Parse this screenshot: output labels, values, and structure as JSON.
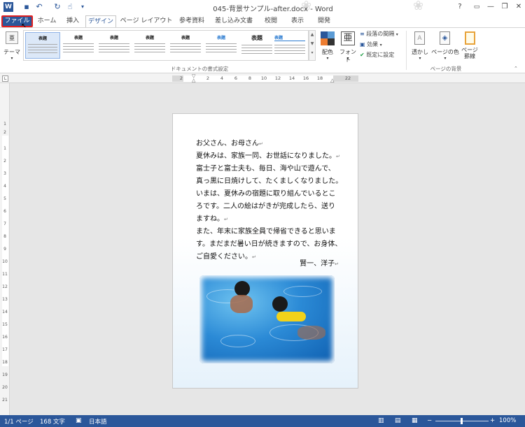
{
  "titlebar": {
    "app_icon": "W",
    "title": "045-背景サンプル-after.docx - Word",
    "help": "?",
    "minimize": "—",
    "restore": "❐",
    "close": "✕"
  },
  "tabs": [
    "ファイル",
    "ホーム",
    "挿入",
    "デザイン",
    "ページ レイアウト",
    "参考資料",
    "差し込み文書",
    "校閲",
    "表示",
    "開発"
  ],
  "ribbon": {
    "theme_label": "テーマ",
    "thumb_titles": [
      "表題",
      "表題",
      "表題",
      "表題",
      "表題",
      "表題",
      "表題",
      "表題"
    ],
    "colors_label": "配色",
    "fonts_label": "フォント",
    "fonts_glyph": "亜",
    "paragraph_spacing": "段落の間隔",
    "effects": "効果",
    "set_default": "既定に設定",
    "doc_format_group": "ドキュメントの書式設定",
    "watermark_label": "透かし",
    "page_color_label": "ページの色",
    "page_borders_label": "ページ\n罫線",
    "page_bg_group": "ページの背景"
  },
  "ruler": {
    "h_numbers": [
      "2",
      "2",
      "4",
      "6",
      "8",
      "10",
      "12",
      "14",
      "16",
      "18",
      "22"
    ],
    "v_numbers": [
      "1",
      "2",
      "1",
      "2",
      "3",
      "4",
      "5",
      "6",
      "7",
      "8",
      "9",
      "10",
      "11",
      "12",
      "13",
      "14",
      "15",
      "16",
      "17",
      "18",
      "19",
      "20",
      "21"
    ]
  },
  "document": {
    "lines": [
      "お父さん、お母さん",
      "夏休みは、家族一同、お世話になりました。",
      "富士子と富士夫も、毎日、海や山で遊んで、",
      "真っ黒に日焼けして、たくましくなりました。",
      "いまは、夏休みの宿題に取り組んでいるとこ",
      "ろです。二人の絵はがきが完成したら、送り",
      "ますね。",
      "また、年末に家族全員で帰省できると思いま",
      "す。まだまだ暑い日が続きますので、お身体、",
      "ご自愛ください。"
    ],
    "signature": "賢一、洋子",
    "paragraph_mark": "↵"
  },
  "status": {
    "page": "1/1 ページ",
    "words": "168 文字",
    "language": "日本語",
    "zoom": "100%"
  },
  "colors": {
    "accent": "#2b579a",
    "file_tab_outline": "#e02020"
  }
}
